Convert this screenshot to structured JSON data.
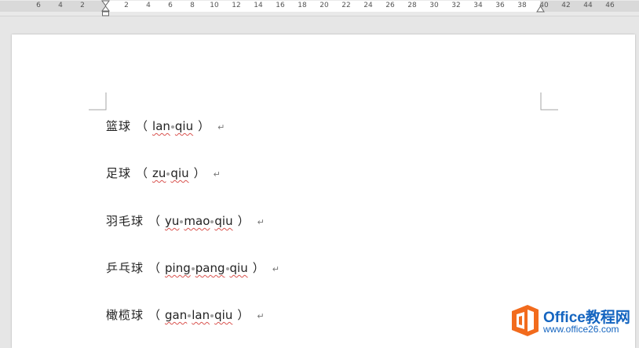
{
  "ruler": {
    "ticks": [
      "6",
      "4",
      "2",
      "2",
      "4",
      "6",
      "8",
      "10",
      "12",
      "14",
      "16",
      "18",
      "20",
      "22",
      "24",
      "26",
      "28",
      "30",
      "32",
      "34",
      "36",
      "38",
      "40",
      "42",
      "44",
      "46"
    ]
  },
  "document": {
    "paragraphs": [
      {
        "hanzi": "篮球",
        "open": "（",
        "pinyin": [
          "lan",
          "qiu"
        ],
        "close": "）"
      },
      {
        "hanzi": "足球",
        "open": "（",
        "pinyin": [
          "zu",
          "qiu"
        ],
        "close": "）"
      },
      {
        "hanzi": "羽毛球",
        "open": "（",
        "pinyin": [
          "yu",
          "mao",
          "qiu"
        ],
        "close": "）"
      },
      {
        "hanzi": "乒乓球",
        "open": "（",
        "pinyin": [
          "ping",
          "pang",
          "qiu"
        ],
        "close": "）"
      },
      {
        "hanzi": "橄榄球",
        "open": "（",
        "pinyin": [
          "gan",
          "lan",
          "qiu"
        ],
        "close": "）"
      }
    ],
    "pilcrow": "↵"
  },
  "watermark": {
    "brand": "Office教程网",
    "url": "www.office26.com",
    "colors": {
      "orange": "#f26b1d",
      "blue": "#1565c0"
    }
  }
}
